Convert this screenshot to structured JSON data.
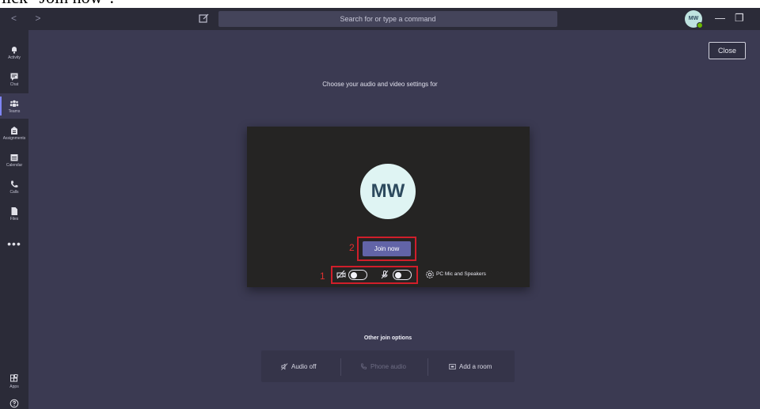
{
  "caption": "lick \"Join now\".",
  "titlebar": {
    "nav": "<  >",
    "search_placeholder": "Search for or type a command",
    "avatar_initials": "MW",
    "minimize": "—",
    "maximize": "❐"
  },
  "rail": {
    "items": [
      {
        "label": "Activity",
        "icon": "bell-icon"
      },
      {
        "label": "Chat",
        "icon": "chat-icon"
      },
      {
        "label": "Teams",
        "icon": "teams-icon"
      },
      {
        "label": "Assignments",
        "icon": "assignments-icon"
      },
      {
        "label": "Calendar",
        "icon": "calendar-icon"
      },
      {
        "label": "Calls",
        "icon": "phone-icon"
      },
      {
        "label": "Files",
        "icon": "file-icon"
      }
    ],
    "more": "•••",
    "apps_label": "Apps"
  },
  "main": {
    "close_label": "Close",
    "heading": "Choose your audio and video settings for",
    "avatar_initials": "MW",
    "join_label": "Join now",
    "annotation_1": "1",
    "annotation_2": "2",
    "device_label": "PC Mic and Speakers",
    "other_title": "Other join options",
    "options": {
      "audio_off": "Audio off",
      "phone_audio": "Phone audio",
      "add_room": "Add a room"
    }
  },
  "colors": {
    "accent": "#6264a7",
    "annotation_red": "#d01e2a",
    "background": "#3b3a52",
    "rail": "#2b2b38"
  }
}
